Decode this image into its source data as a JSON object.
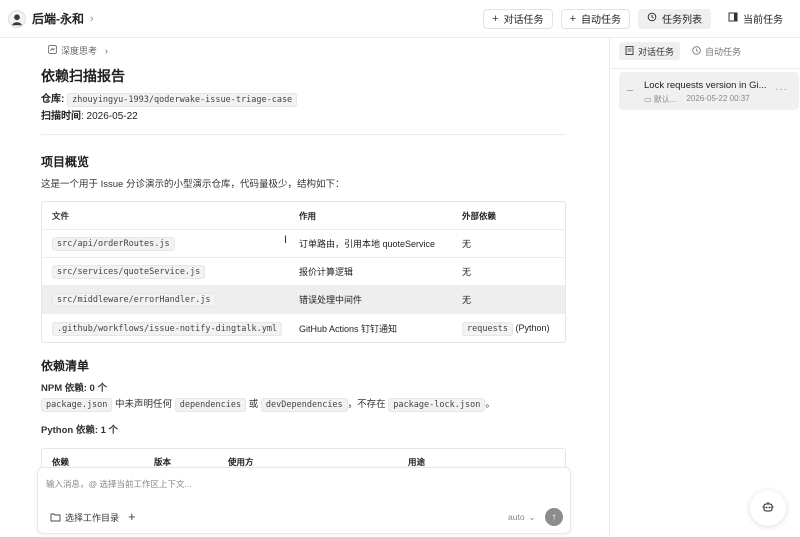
{
  "header": {
    "project_title": "后端-永和",
    "buttons": [
      {
        "label": "对话任务",
        "icon": "plus-icon"
      },
      {
        "label": "自动任务",
        "icon": "plus-icon"
      },
      {
        "label": "任务列表",
        "icon": "history-icon"
      },
      {
        "label": "当前任务",
        "icon": "panel-icon"
      }
    ]
  },
  "main": {
    "thinking_label": "深度思考",
    "report_title": "依赖扫描报告",
    "repo_label": "仓库:",
    "repo_value": "zhouyingyu-1993/qoderwake-issue-triage-case",
    "scan_time_label": "扫描时间",
    "scan_time_value": ": 2026-05-22",
    "overview_heading": "项目概览",
    "overview_text": "这是一个用于 Issue 分诊演示的小型演示仓库，代码量极少，结构如下：",
    "table": {
      "headers": [
        "文件",
        "作用",
        "外部依赖"
      ],
      "rows": [
        {
          "file": "src/api/orderRoutes.js",
          "role": "订单路由，引用本地 quoteService",
          "dep": "无",
          "dep_code": "",
          "dep_suffix": ""
        },
        {
          "file": "src/services/quoteService.js",
          "role": "报价计算逻辑",
          "dep": "无",
          "dep_code": "",
          "dep_suffix": ""
        },
        {
          "file": "src/middleware/errorHandler.js",
          "role": "错误处理中间件",
          "dep": "无",
          "dep_code": "",
          "dep_suffix": ""
        },
        {
          "file": ".github/workflows/issue-notify-dingtalk.yml",
          "role": "GitHub Actions 钉钉通知",
          "dep": "",
          "dep_code": "requests",
          "dep_suffix": " (Python)"
        }
      ]
    },
    "deps_heading": "依赖清单",
    "npm_heading": "NPM 依赖: 0 个",
    "npm_parts": {
      "code1": "package.json",
      "t1": " 中未声明任何 ",
      "code2": "dependencies",
      "t2": " 或 ",
      "code3": "devDependencies",
      "t3": "，不存在 ",
      "code4": "package-lock.json",
      "t4": "。"
    },
    "python_heading": "Python 依赖: 1 个",
    "table2_headers": [
      "依赖",
      "版本",
      "使用方",
      "用途"
    ]
  },
  "composer": {
    "placeholder": "输入消息，@ 选择当前工作区上下文...",
    "dir_button": "选择工作目录",
    "model": "auto"
  },
  "sidebar": {
    "tabs": [
      {
        "label": "对话任务",
        "active": true
      },
      {
        "label": "自动任务",
        "active": false
      }
    ],
    "task": {
      "title": "Lock requests version in Gi...",
      "workspace": "默认...",
      "time": "2026-05-22 00:37"
    }
  }
}
